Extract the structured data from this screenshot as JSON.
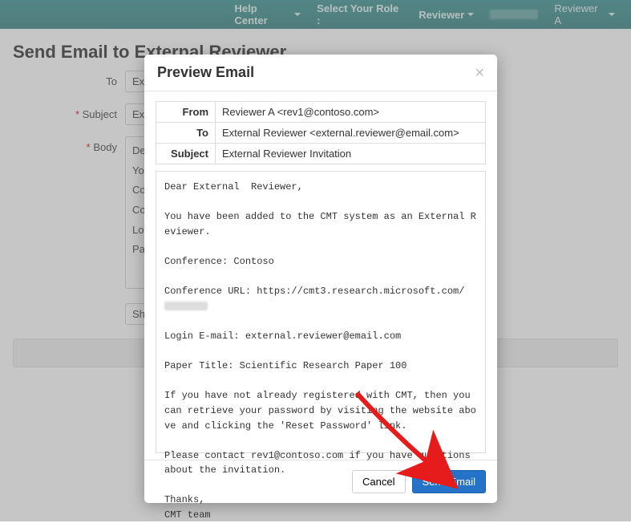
{
  "nav": {
    "help": "Help Center",
    "select_role": "Select Your Role :",
    "role": "Reviewer",
    "user": "Reviewer A"
  },
  "page": {
    "title": "Send Email to External Reviewer",
    "labels": {
      "to": "To",
      "subject": "Subject",
      "body": "Body"
    },
    "values": {
      "to": "External Reviewer <external.reviewer@email.com>",
      "subject": "External Reviewer Invitation",
      "body_lines": [
        "Dear External Reviewer,",
        "You have been added...",
        "Conference: Contoso",
        "Conference URL: https://cmt3.research.microsoft.com/",
        "Login E-mail: external.reviewer@email.com",
        "Paper Title: Scientific Research Paper 100"
      ],
      "body_short0": "De",
      "body_short1": "Yo",
      "body_short2": "Co",
      "body_short3": "Co",
      "body_short4": "Lo",
      "body_short5": "Pa"
    },
    "show_preview": "Show Preview",
    "show_preview_short": "Sh"
  },
  "modal": {
    "title": "Preview Email",
    "close": "×",
    "from_label": "From",
    "to_label": "To",
    "subject_label": "Subject",
    "from": "Reviewer A <rev1@contoso.com>",
    "to": "External Reviewer <external.reviewer@email.com>",
    "subject": "External Reviewer Invitation",
    "body_pre": "Dear External  Reviewer,\n\nYou have been added to the CMT system as an External Reviewer.\n\nConference: Contoso\n\nConference URL: https://cmt3.research.microsoft.com/",
    "body_post": "\n\nLogin E-mail: external.reviewer@email.com\n\nPaper Title: Scientific Research Paper 100\n\nIf you have not already registered with CMT, then you can retrieve your password by visiting the website above and clicking the 'Reset Password' link.\n\nPlease contact rev1@contoso.com if you have questions about the invitation.\n\nThanks,\nCMT team",
    "cancel": "Cancel",
    "send": "Send Email"
  }
}
